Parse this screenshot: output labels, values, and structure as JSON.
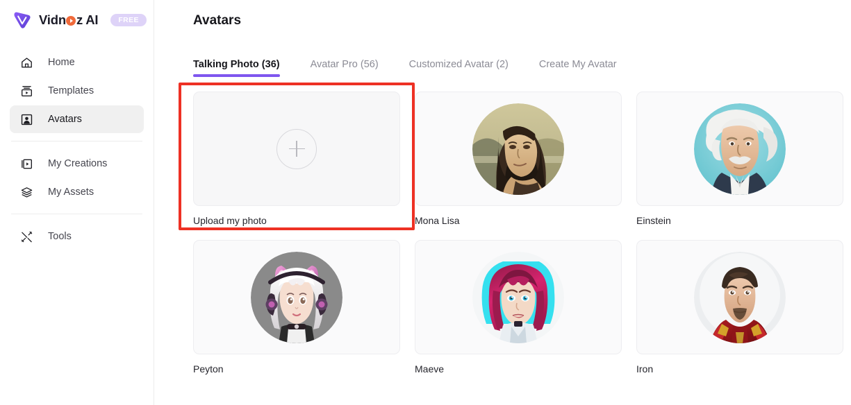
{
  "brand": {
    "name_part1": "Vidn",
    "name_o": "o",
    "name_part2": "z AI",
    "badge": "FREE",
    "logo_icon": "vidnoz-v-logo-icon"
  },
  "sidebar": {
    "groups": [
      {
        "items": [
          {
            "label": "Home",
            "icon": "home-icon",
            "active": false
          },
          {
            "label": "Templates",
            "icon": "templates-icon",
            "active": false
          },
          {
            "label": "Avatars",
            "icon": "avatar-person-icon",
            "active": true
          }
        ]
      },
      {
        "items": [
          {
            "label": "My Creations",
            "icon": "video-play-icon",
            "active": false
          },
          {
            "label": "My Assets",
            "icon": "layers-stack-icon",
            "active": false
          }
        ]
      },
      {
        "items": [
          {
            "label": "Tools",
            "icon": "wrench-tools-icon",
            "active": false
          }
        ]
      }
    ]
  },
  "main": {
    "title": "Avatars",
    "tabs": [
      {
        "label": "Talking Photo (36)",
        "active": true
      },
      {
        "label": "Avatar Pro (56)",
        "active": false
      },
      {
        "label": "Customized Avatar (2)",
        "active": false
      },
      {
        "label": "Create My Avatar",
        "active": false
      }
    ],
    "cards": [
      {
        "label": "Upload my photo",
        "type": "upload",
        "icon": "plus-circle-icon",
        "highlighted": true
      },
      {
        "label": "Mona Lisa",
        "type": "avatar",
        "avatar": "mona-lisa"
      },
      {
        "label": "Einstein",
        "type": "avatar",
        "avatar": "einstein"
      },
      {
        "label": "Peyton",
        "type": "avatar",
        "avatar": "peyton"
      },
      {
        "label": "Maeve",
        "type": "avatar",
        "avatar": "maeve"
      },
      {
        "label": "Iron",
        "type": "avatar",
        "avatar": "iron"
      }
    ]
  },
  "colors": {
    "accent_purple": "#7f56ef",
    "annotation_red": "#ee3124",
    "badge_lavender": "#ded3f8",
    "active_nav_bg": "#f0f0f0",
    "card_bg": "#fafafb"
  }
}
